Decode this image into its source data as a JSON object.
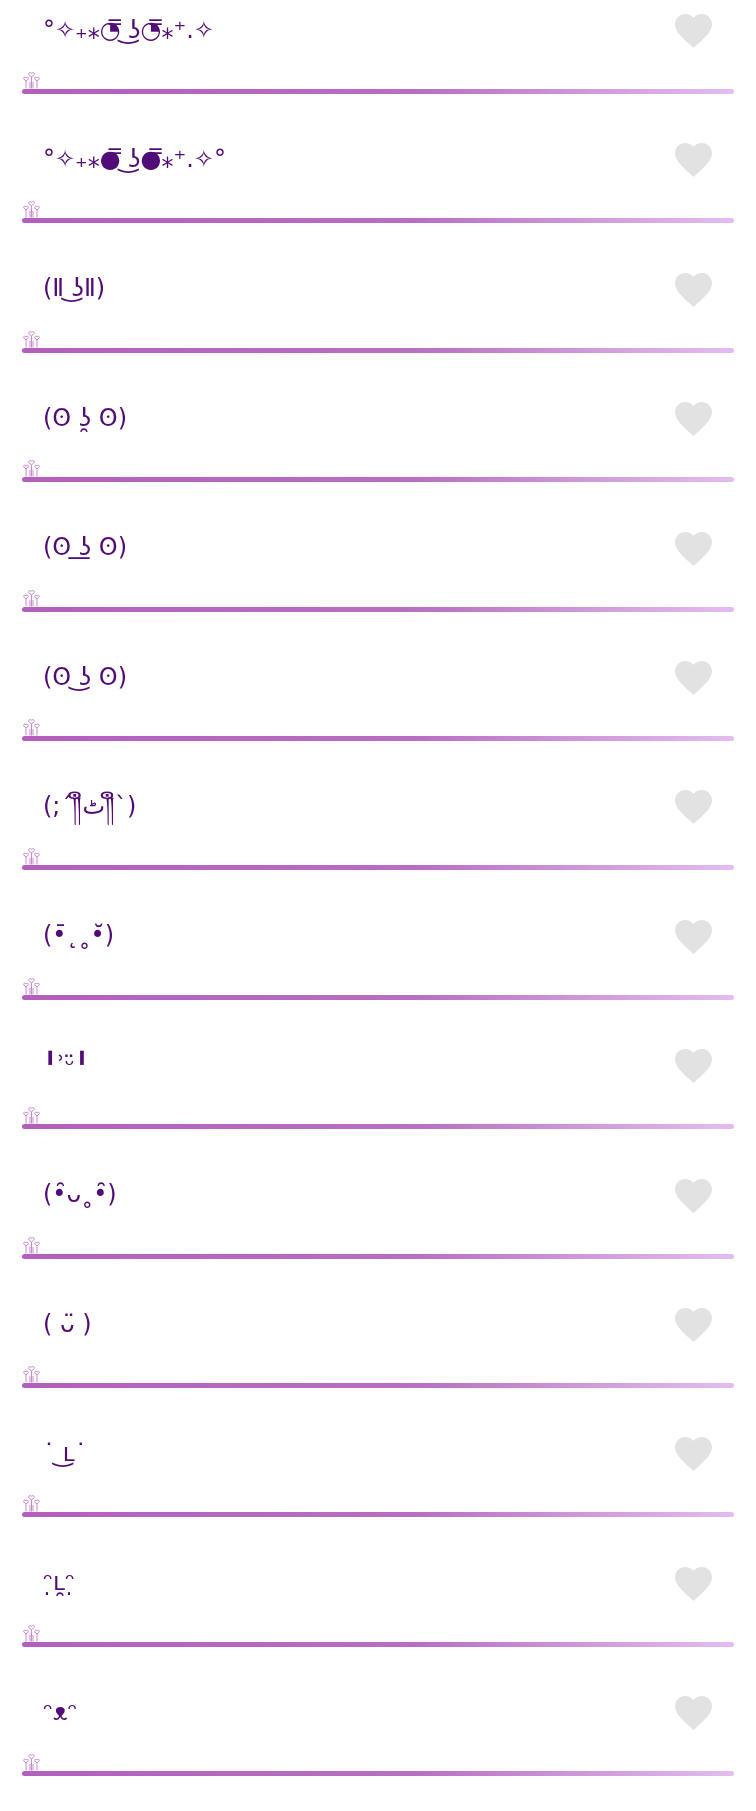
{
  "items": [
    {
      "kaomoji": "°✧₊⁎◔̿ ͜ʖ◔̿⁎⁺.✧",
      "liked": false
    },
    {
      "kaomoji": "°✧₊⁎●̿ ͜ʖ●̿⁎⁺.✧°",
      "liked": false
    },
    {
      "kaomoji": "(Ⅱ ͜ʖⅡ)",
      "liked": false
    },
    {
      "kaomoji": "(ʘ ʖ̯ ʘ)",
      "liked": false
    },
    {
      "kaomoji": "(ʘ ͟ʖ ʘ)",
      "liked": false
    },
    {
      "kaomoji": "(ʘ ͜ʖ ʘ)",
      "liked": false
    },
    {
      "kaomoji": "(;´༎ຶٹ༎ຶ`)",
      "liked": false
    },
    {
      "kaomoji": "(•̄˛˳•̆)",
      "liked": false
    },
    {
      "kaomoji": "╹ʾᵕ̈╹",
      "liked": false
    },
    {
      "kaomoji": "(•̑ᴗ˳•̑)",
      "liked": false
    },
    {
      "kaomoji": "( ᴗ̈ )",
      "liked": false
    },
    {
      "kaomoji": "˙ ͜ʟ˙",
      "liked": false
    },
    {
      "kaomoji": "ᵔ̣ʟ̯ᵔ̣",
      "liked": false
    },
    {
      "kaomoji": "ᵔᴥᵔ",
      "liked": false
    }
  ]
}
